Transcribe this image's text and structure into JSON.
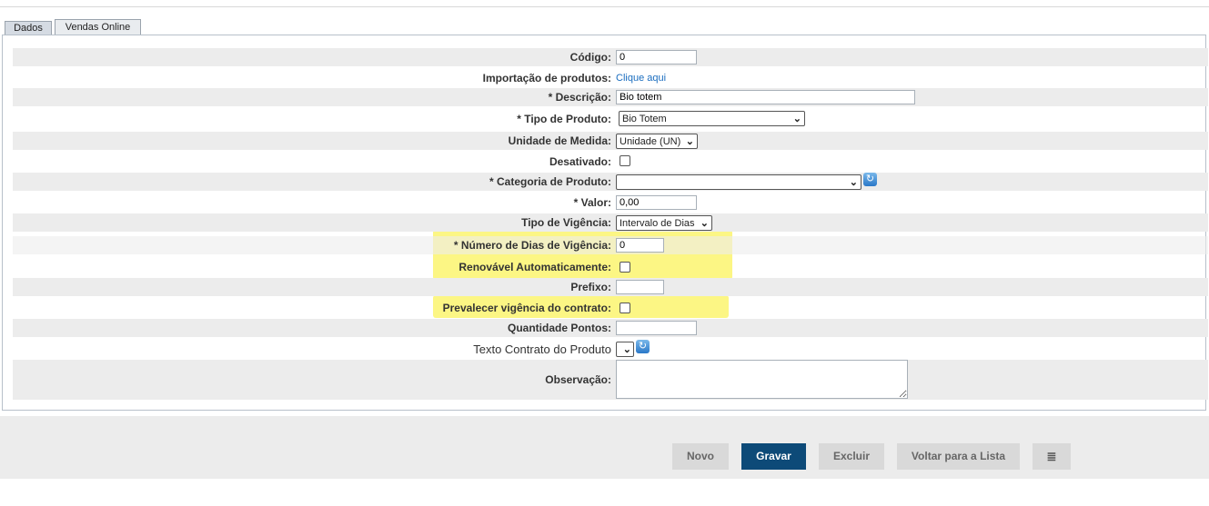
{
  "tabs": [
    {
      "label": "Dados"
    },
    {
      "label": "Vendas Online"
    }
  ],
  "form": {
    "codigo": {
      "label": "Código:",
      "value": "0"
    },
    "importacao": {
      "label": "Importação de produtos:",
      "link": "Clique aqui"
    },
    "descricao": {
      "label": "* Descrição:",
      "value": "Bio totem"
    },
    "tipo_produto": {
      "label": "* Tipo de Produto:",
      "value": "Bio Totem"
    },
    "unidade_medida": {
      "label": "Unidade de Medida:",
      "value": "Unidade (UN)"
    },
    "desativado": {
      "label": "Desativado:",
      "checked": false
    },
    "categoria_produto": {
      "label": "* Categoria de Produto:",
      "value": ""
    },
    "valor": {
      "label": "* Valor:",
      "value": "0,00"
    },
    "tipo_vigencia": {
      "label": "Tipo de Vigência:",
      "value": "Intervalo de Dias"
    },
    "numero_dias": {
      "label": "* Número de Dias de Vigência:",
      "value": "0"
    },
    "renovavel": {
      "label": "Renovável Automaticamente:",
      "checked": false
    },
    "prefixo": {
      "label": "Prefixo:",
      "value": ""
    },
    "prevalecer": {
      "label": "Prevalecer vigência do contrato:",
      "checked": false
    },
    "quantidade_pontos": {
      "label": "Quantidade Pontos:",
      "value": ""
    },
    "texto_contrato": {
      "label": "Texto Contrato do Produto",
      "value": ""
    },
    "observacao": {
      "label": "Observação:",
      "value": ""
    }
  },
  "highlight_color": "#fbf46e",
  "buttons": {
    "novo": "Novo",
    "gravar": "Gravar",
    "excluir": "Excluir",
    "voltar": "Voltar para a Lista",
    "menu_icon": "list-icon"
  }
}
